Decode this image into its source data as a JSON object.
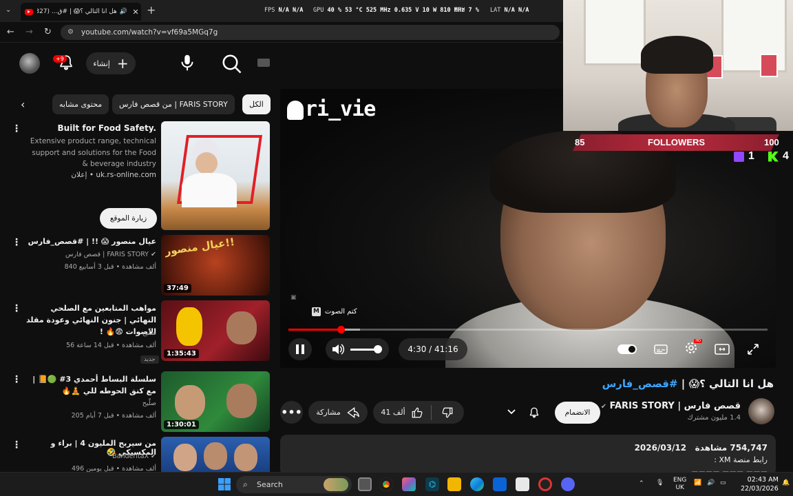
{
  "browser": {
    "tab_title": "هل انا التالي ؟😱 | #ق... (327)",
    "url": "youtube.com/watch?v=vf69a5MGq7g",
    "perf": {
      "fps_label": "FPS",
      "fps_value": "N/A N/A",
      "gpu_label": "GPU",
      "gpu_value": "40 % 53 °C 525 MHz 0.635 V 10 W 810 MHz",
      "cpu_label": "CPU",
      "cpu_value": "7 %",
      "lat_label": "LAT",
      "lat_value": "N/A N/A"
    }
  },
  "header": {
    "notif_badge": "+9",
    "create_label": "إنشاء"
  },
  "chips": {
    "all": "الكل",
    "channel": "من قصص فارس | FARIS STORY",
    "similar": "محتوى مشابه"
  },
  "sidebar": {
    "ad": {
      "title": "Built for Food Safety.",
      "body": "Extensive product range, technical support and solutions for the Food & beverage industry",
      "source": "إعلان • uk.rs-online.com",
      "visit_label": "زيارة الموقع"
    },
    "items": [
      {
        "title": "عيال منصور 😱 !! | #قصص_فارس",
        "channel": "قصص فارس | FARIS STORY",
        "meta": "840 ألف مشاهدة • قبل 3 أسابيع",
        "duration": "37:49"
      },
      {
        "title": "مواهب المتابعين مع الصلحي النهائي | جنون النهائي وعودة مقلد الاصوات 😨🔥 !",
        "channel": "صلّيح",
        "meta": "56 ألف مشاهدة • قبل 14 ساعة",
        "duration": "1:35:43",
        "tag": "جديد"
      },
      {
        "title": "سلسلة البساط أحمدي 3# 🟢📙 | مع كنق الحوطه للي 🧘🔥",
        "channel": "صلّيح",
        "meta": "205 ألف مشاهدة • قبل 7 أيام",
        "duration": "1:30:01"
      },
      {
        "title": "من سيربح المليون 4 | براء و المكسيكي 🤣",
        "channel": "BanderitaX",
        "meta": "496 ألف مشاهدة • قبل يومين",
        "duration": ""
      }
    ]
  },
  "player": {
    "watermark": "ri_vie",
    "mute_tip": "كتم الصوت",
    "mute_key": "M",
    "time": "4:30 / 41:16",
    "progress": 0.109,
    "buffered": 0.15,
    "volume": 0.8
  },
  "webcam": {
    "followers_label": "FOLLOWERS",
    "followers_current": "85",
    "followers_goal": "100",
    "twitch_count": "1",
    "kick_count": "4"
  },
  "video": {
    "title_main": "هل انا التالي ؟😱 |",
    "title_tag": "#قصص_فارس",
    "channel_name": "قصص فارس | FARIS STORY",
    "subs": "1.4 مليون مشترك",
    "join_label": "الانضمام",
    "likes": "41 ألف",
    "share_label": "مشاركة",
    "views": "754,747 مشاهدة",
    "date": "2026/03/12",
    "desc_line": "رابط منصة XM :"
  },
  "taskbar": {
    "search_label": "Search",
    "lang_top": "ENG",
    "lang_bottom": "UK",
    "time": "02:43 AM",
    "date": "22/03/2026"
  }
}
